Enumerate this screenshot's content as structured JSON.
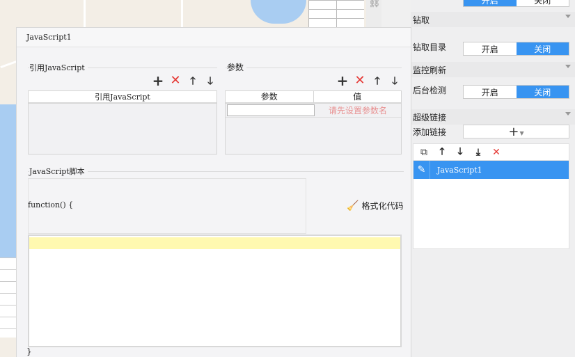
{
  "dialog": {
    "title": "JavaScript1",
    "ref_group": {
      "title": "引用JavaScript",
      "column_header": "引用JavaScript"
    },
    "param_group": {
      "title": "参数",
      "col_param": "参数",
      "col_value": "值",
      "value_placeholder": "请先设置参数名"
    },
    "script_group": {
      "title": "JavaScript脚本",
      "function_header": "function() {",
      "format_label": "格式化代码",
      "closing_brace": "}"
    },
    "toolbar_icons": [
      "add-icon",
      "delete-icon",
      "arrow-up-icon",
      "arrow-down-icon"
    ]
  },
  "right_panel": {
    "top_toggle": {
      "on": "开启",
      "off": "关闭"
    },
    "drill": {
      "section": "钻取",
      "dir_label": "钻取目录",
      "on": "开启",
      "off": "关闭"
    },
    "monitor": {
      "section": "监控刷新",
      "bg_label": "后台检测",
      "on": "开启",
      "off": "关闭"
    },
    "hyperlink": {
      "section": "超级链接",
      "add_label": "添加链接",
      "add_symbol": "+",
      "items": [
        {
          "name": "JavaScript1"
        }
      ]
    }
  },
  "colors": {
    "accent": "#3894f1",
    "delete": "#e53935",
    "highlight_line": "#fff9b0"
  }
}
